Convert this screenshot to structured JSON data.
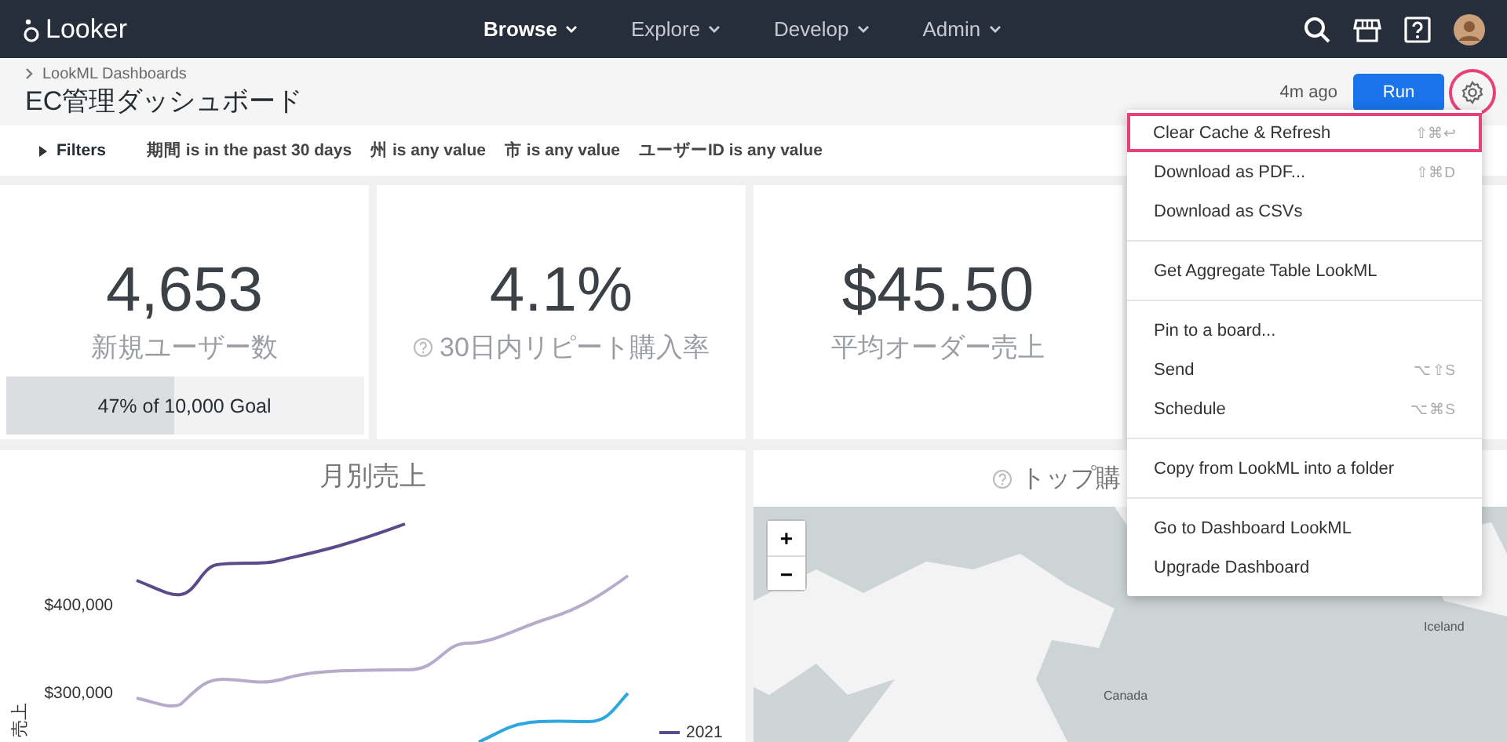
{
  "app_bar": {
    "logo": "Looker",
    "nav": [
      {
        "label": "Browse",
        "selected": true
      },
      {
        "label": "Explore",
        "selected": false
      },
      {
        "label": "Develop",
        "selected": false
      },
      {
        "label": "Admin",
        "selected": false
      }
    ]
  },
  "dashboard_header": {
    "breadcrumb": "LookML Dashboards",
    "title": "EC管理ダッシュボード",
    "updated": "4m ago",
    "run_button": "Run",
    "gear_highlighted": true
  },
  "filters": {
    "toggle": "Filters",
    "items": [
      "期間 is in the past 30 days",
      "州 is any value",
      "市 is any value",
      "ユーザーID is any value"
    ]
  },
  "kpi_tiles": [
    {
      "value": "4,653",
      "label": "新規ユーザー数",
      "help": false,
      "goal": {
        "text": "47% of 10,000 Goal",
        "level": 0.47
      }
    },
    {
      "value": "4.1%",
      "label": "30日内リピート購入率",
      "help": true
    },
    {
      "value": "$45.50",
      "label": "平均オーダー売上",
      "help": false
    }
  ],
  "monthly_sales_tile": {
    "title": "月別売上",
    "y_axis_title": "売上",
    "y_tick_labels": [
      "$400,000",
      "$300,000"
    ],
    "legend": [
      "2021"
    ]
  },
  "map_tile": {
    "title": "トップ購",
    "help": true,
    "zoom_in": "+",
    "zoom_out": "−",
    "place_labels": [
      "Canada",
      "Iceland"
    ]
  },
  "menu": {
    "groups": [
      {
        "items": [
          {
            "label": "Clear Cache & Refresh",
            "shortcut": "⇧⌘↩",
            "highlighted": true
          },
          {
            "label": "Download as PDF...",
            "shortcut": "⇧⌘D",
            "highlighted": false
          },
          {
            "label": "Download as CSVs",
            "highlighted": false
          }
        ]
      },
      {
        "items": [
          {
            "label": "Get Aggregate Table LookML",
            "highlighted": false
          }
        ]
      },
      {
        "items": [
          {
            "label": "Pin to a board...",
            "highlighted": false
          },
          {
            "label": "Send",
            "shortcut": "⌥⇧S",
            "highlighted": false
          },
          {
            "label": "Schedule",
            "shortcut": "⌥⌘S",
            "highlighted": false
          }
        ]
      },
      {
        "items": [
          {
            "label": "Copy from LookML into a folder",
            "highlighted": false
          }
        ]
      },
      {
        "items": [
          {
            "label": "Go to Dashboard LookML",
            "highlighted": false
          },
          {
            "label": "Upgrade Dashboard",
            "highlighted": false
          }
        ]
      }
    ]
  }
}
